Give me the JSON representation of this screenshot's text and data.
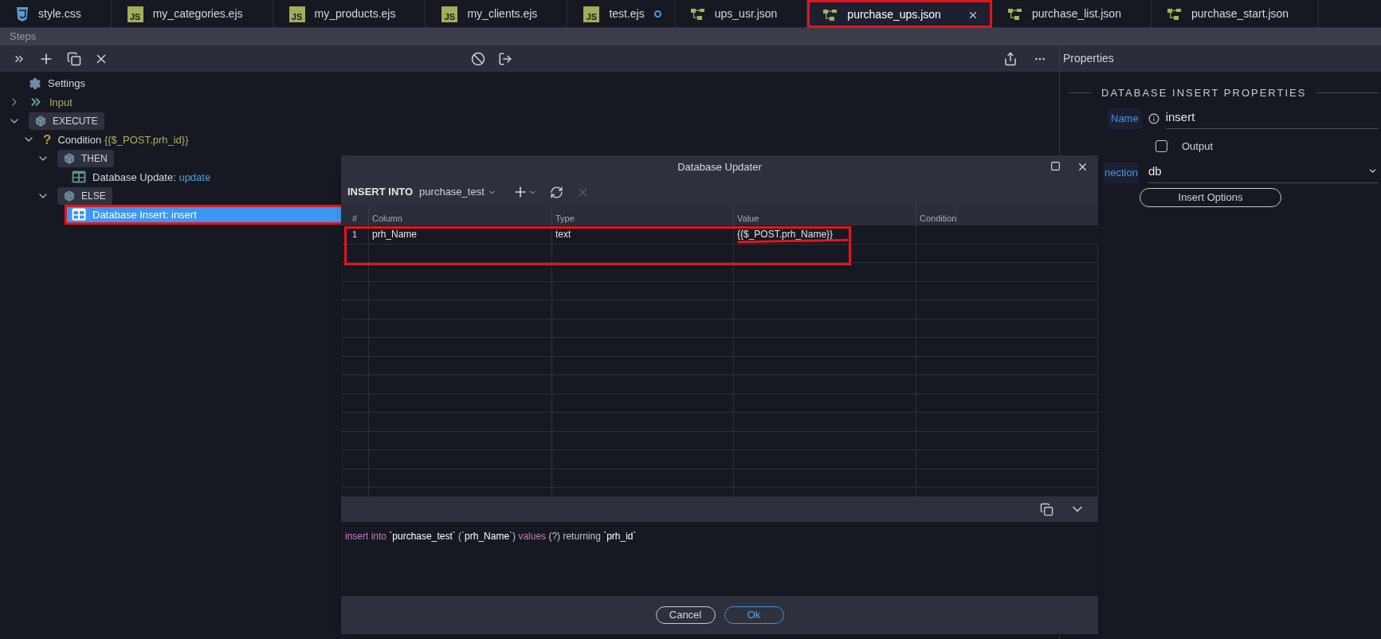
{
  "tabs": [
    {
      "kind": "css",
      "label": "style.css",
      "selected": false,
      "modified": false,
      "annotated": false
    },
    {
      "kind": "js",
      "badge": "JS",
      "label": "my_categories.ejs",
      "selected": false,
      "modified": false,
      "annotated": false
    },
    {
      "kind": "js",
      "badge": "JS",
      "label": "my_products.ejs",
      "selected": false,
      "modified": false,
      "annotated": false
    },
    {
      "kind": "js",
      "badge": "JS",
      "label": "my_clients.ejs",
      "selected": false,
      "modified": false,
      "annotated": false
    },
    {
      "kind": "js",
      "badge": "JS",
      "label": "test.ejs",
      "selected": false,
      "modified": true,
      "annotated": false
    },
    {
      "kind": "flow",
      "label": "ups_usr.json",
      "selected": false,
      "modified": false,
      "annotated": false
    },
    {
      "kind": "flow",
      "label": "purchase_ups.json",
      "selected": true,
      "modified": false,
      "annotated": true
    },
    {
      "kind": "flow",
      "label": "purchase_list.json",
      "selected": false,
      "modified": false,
      "annotated": false
    },
    {
      "kind": "flow",
      "label": "purchase_start.json",
      "selected": false,
      "modified": false,
      "annotated": false
    }
  ],
  "steps": {
    "title": "Steps"
  },
  "tree": [
    {
      "kind": "settings",
      "label": "Settings",
      "selected": false,
      "annotated": false
    },
    {
      "kind": "input",
      "label": "Input",
      "expanded": false,
      "selected": false,
      "annotated": false
    },
    {
      "kind": "group",
      "label": "EXECUTE",
      "expanded": true,
      "selected": false,
      "annotated": false,
      "children": [
        {
          "kind": "condition",
          "icon_char": "?",
          "label": "Condition",
          "detail": "{{$_POST.prh_id}}",
          "expanded": true,
          "selected": false,
          "annotated": false,
          "children": [
            {
              "kind": "group",
              "label": "THEN",
              "expanded": true,
              "selected": false,
              "annotated": false,
              "children": [
                {
                  "kind": "step",
                  "label": "Database Update:",
                  "detail": "update",
                  "selected": false,
                  "annotated": false
                }
              ]
            },
            {
              "kind": "group",
              "label": "ELSE",
              "expanded": true,
              "selected": false,
              "annotated": false,
              "children": [
                {
                  "kind": "step",
                  "label": "Database Insert:",
                  "detail": "insert",
                  "selected": true,
                  "annotated": true
                }
              ]
            }
          ]
        }
      ]
    }
  ],
  "properties": {
    "title": "Properties",
    "section": "DATABASE INSERT PROPERTIES",
    "name_label": "Name",
    "name_value": "insert",
    "output": {
      "label": "Output",
      "checked": false
    },
    "connection_label": "nection",
    "connection_value": "db",
    "options_button": "Insert Options"
  },
  "dialog": {
    "title": "Database Updater",
    "insert_into": "INSERT INTO",
    "table": "purchase_test",
    "remove_disabled": true,
    "columns": [
      "#",
      "Column",
      "Type",
      "Value",
      "Condition"
    ],
    "rows": [
      {
        "index": "1",
        "column": "prh_Name",
        "type": "text",
        "value": "{{$_POST.prh_Name}}",
        "annotated": true,
        "value_underlined": true
      }
    ],
    "sql": [
      {
        "kind": "keyword",
        "text": "insert into "
      },
      {
        "kind": "ident",
        "text": "`purchase_test`"
      },
      {
        "kind": "plain",
        "text": " (`"
      },
      {
        "kind": "ident",
        "text": "prh_Name"
      },
      {
        "kind": "plain",
        "text": "`) "
      },
      {
        "kind": "keyword",
        "text": "values "
      },
      {
        "kind": "plain",
        "text": "(?) returning "
      },
      {
        "kind": "ident",
        "text": "`prh_id`"
      }
    ],
    "buttons": [
      {
        "kind": "secondary",
        "label": "Cancel"
      },
      {
        "kind": "primary",
        "label": "Ok"
      }
    ]
  }
}
